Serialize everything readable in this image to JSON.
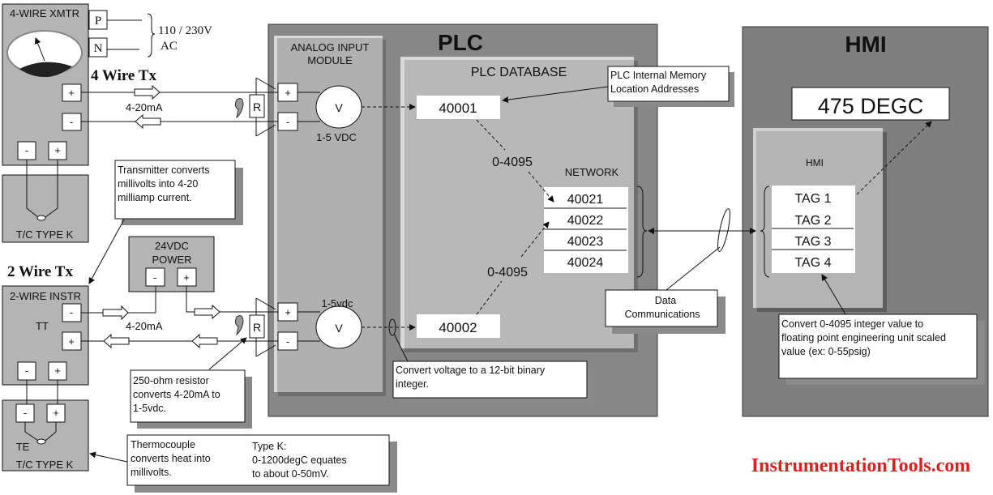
{
  "four_wire": {
    "heading": "4 Wire Tx",
    "xmtr_label": "4-WIRE XMTR",
    "power_p": "P",
    "power_n": "N",
    "supply_line1": "110 / 230V",
    "supply_line2": "AC",
    "plus": "+",
    "minus": "-",
    "current": "4-20mA",
    "tc_label": "T/C TYPE K",
    "resistor": "R"
  },
  "two_wire": {
    "heading": "2 Wire Tx",
    "instr_label": "2-WIRE INSTR",
    "tt": "TT",
    "te": "TE",
    "tc_label": "T/C TYPE K",
    "plus": "+",
    "minus": "-",
    "current": "4-20mA",
    "resistor": "R",
    "power_line1": "24VDC",
    "power_line2": "POWER"
  },
  "notes": {
    "transmitter": [
      "Transmitter converts",
      "millivolts into 4-20",
      "milliamp current."
    ],
    "resistor": [
      "250-ohm resistor",
      "converts 4-20mA to",
      "1-5vdc."
    ],
    "thermocouple": [
      "Thermocouple",
      "converts heat into",
      "millivolts."
    ],
    "typek": [
      "Type K:",
      "0-1200degC equates",
      "to about 0-50mV."
    ],
    "convert_voltage": [
      "Convert voltage to a 12-bit binary",
      "integer."
    ],
    "memory": [
      "PLC Internal Memory",
      "Location Addresses"
    ],
    "datacomm": [
      "Data",
      "Communications"
    ],
    "convert_int": [
      "Convert 0-4095 integer value  to",
      "floating point engineering unit scaled",
      "value (ex: 0-55psig)"
    ]
  },
  "plc": {
    "title": "PLC",
    "aim_line1": "ANALOG INPUT",
    "aim_line2": "MODULE",
    "voltmeter": "V",
    "v1_label": "1-5 VDC",
    "v2_label": "1-5vdc",
    "db_title": "PLC DATABASE",
    "reg1": "40001",
    "reg2": "40002",
    "range1": "0-4095",
    "range2": "0-4095",
    "network_title": "NETWORK",
    "network": [
      "40021",
      "40022",
      "40023",
      "40024"
    ]
  },
  "hmi": {
    "title": "HMI",
    "display": "475 DEGC",
    "inner_title": "HMI",
    "tags": [
      "TAG 1",
      "TAG 2",
      "TAG 3",
      "TAG 4"
    ]
  },
  "watermark": "InstrumentationTools.com",
  "colors": {
    "watermark": "#e02020",
    "panel_dark": "#858585",
    "panel_light": "#b4b4b4"
  }
}
